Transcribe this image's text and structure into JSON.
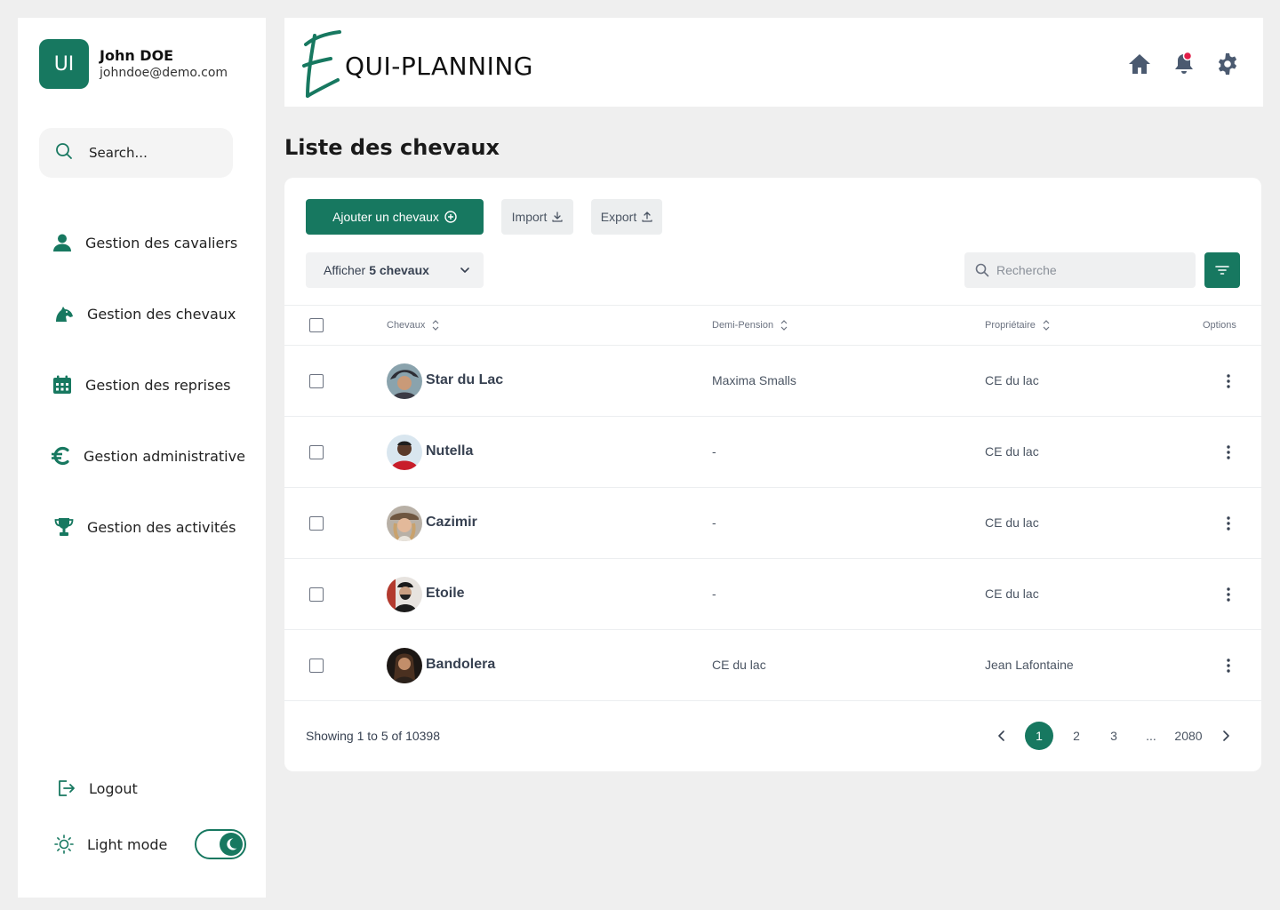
{
  "user": {
    "initials": "UI",
    "name": "John DOE",
    "email": "johndoe@demo.com"
  },
  "sidebar": {
    "search_label": "Search...",
    "items": [
      {
        "label": "Gestion des cavaliers",
        "icon": "user-icon"
      },
      {
        "label": "Gestion des chevaux",
        "icon": "horse-icon"
      },
      {
        "label": "Gestion des reprises",
        "icon": "calendar-icon"
      },
      {
        "label": "Gestion administrative",
        "icon": "euro-icon"
      },
      {
        "label": "Gestion des activités",
        "icon": "trophy-icon"
      }
    ],
    "logout_label": "Logout",
    "light_mode_label": "Light mode",
    "dark_mode_enabled": true
  },
  "header": {
    "logo_text": "QUI-PLANNING",
    "logo_letter": "E",
    "icons": [
      "home-icon",
      "bell-icon",
      "gear-icon"
    ],
    "notification_dot": true
  },
  "page": {
    "title": "Liste des chevaux"
  },
  "toolbar": {
    "add_label": "Ajouter un chevaux",
    "import_label": "Import",
    "export_label": "Export",
    "show_prefix": "Afficher",
    "show_value": "5 chevaux",
    "search_placeholder": "Recherche"
  },
  "table": {
    "columns": {
      "horse": "Chevaux",
      "demi": "Demi-Pension",
      "owner": "Propriétaire",
      "options": "Options"
    },
    "rows": [
      {
        "name": "Star du Lac",
        "demi": "Maxima Smalls",
        "owner": "CE du lac"
      },
      {
        "name": "Nutella",
        "demi": "-",
        "owner": "CE du lac"
      },
      {
        "name": "Cazimir",
        "demi": "-",
        "owner": "CE du lac"
      },
      {
        "name": "Etoile",
        "demi": "-",
        "owner": "CE du lac"
      },
      {
        "name": "Bandolera",
        "demi": "CE du lac",
        "owner": "Jean Lafontaine"
      }
    ]
  },
  "pagination": {
    "summary": "Showing 1 to 5 of 10398",
    "pages": [
      "1",
      "2",
      "3",
      "...",
      "2080"
    ],
    "current": "1"
  },
  "colors": {
    "primary": "#177860",
    "notification": "#e11d48",
    "header_icons": "#4b5a70"
  }
}
